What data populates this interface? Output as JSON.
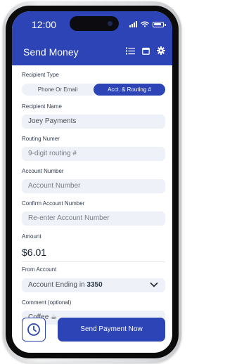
{
  "status_bar": {
    "time": "12:00"
  },
  "header": {
    "title": "Send Money"
  },
  "form": {
    "recipient_type": {
      "label": "Recipient Type",
      "options": [
        "Phone Or Email",
        "Acct. & Routing #"
      ],
      "selected": "Acct. & Routing #"
    },
    "recipient_name": {
      "label": "Recipient Name",
      "value": "Joey Payments"
    },
    "routing_number": {
      "label": "Routing Numer",
      "placeholder": "9-digit routing #"
    },
    "account_number": {
      "label": "Account Number",
      "placeholder": "Account Number"
    },
    "confirm_account_number": {
      "label": "Confirm Account Number",
      "placeholder": "Re-enter Account Number"
    },
    "amount": {
      "label": "Amount",
      "value": "$6.01"
    },
    "from_account": {
      "label": "From Account",
      "value_prefix": "Account Ending in ",
      "value_suffix": "3350"
    },
    "comment": {
      "label": "Comment (optional)",
      "value": "Coffee ☕"
    }
  },
  "actions": {
    "send_label": "Send Payment Now"
  },
  "icons": {
    "list": "list-icon",
    "calendar": "calendar-icon",
    "settings": "gear-icon",
    "history": "clock-icon",
    "dropdown": "chevron-down-icon"
  },
  "colors": {
    "accent": "#2c44b5",
    "field_bg": "#eef1f7"
  }
}
